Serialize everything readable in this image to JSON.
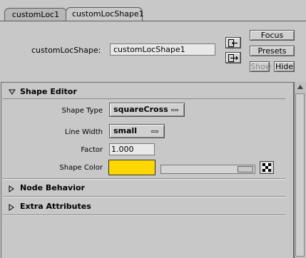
{
  "tabs": [
    {
      "label": "customLoc1",
      "active": false
    },
    {
      "label": "customLocShape1",
      "active": true
    }
  ],
  "node": {
    "label": "customLocShape:",
    "name_value": "customLocShape1"
  },
  "buttons": {
    "focus": "Focus",
    "presets": "Presets",
    "show": "Show",
    "hide": "Hide"
  },
  "sections": {
    "shape_editor": {
      "title": "Shape Editor",
      "expanded": true,
      "shape_type": {
        "label": "Shape Type",
        "value": "squareCross"
      },
      "line_width": {
        "label": "Line Width",
        "value": "small"
      },
      "factor": {
        "label": "Factor",
        "value": "1.000"
      },
      "shape_color": {
        "label": "Shape Color",
        "color": "#ffd700"
      }
    },
    "node_behavior": {
      "title": "Node Behavior",
      "expanded": false
    },
    "extra_attributes": {
      "title": "Extra Attributes",
      "expanded": false
    }
  },
  "icons": {
    "input_connections": "input-connections-icon",
    "output_connections": "output-connections-icon",
    "expand_arrow": "triangle-down-icon",
    "collapse_arrow": "triangle-right-icon",
    "map_button": "checker-icon",
    "scroll_up": "scroll-up-icon"
  },
  "colors": {
    "background": "#c8c8c8",
    "field_bg": "#e8e8e8",
    "swatch": "#ffd700"
  }
}
